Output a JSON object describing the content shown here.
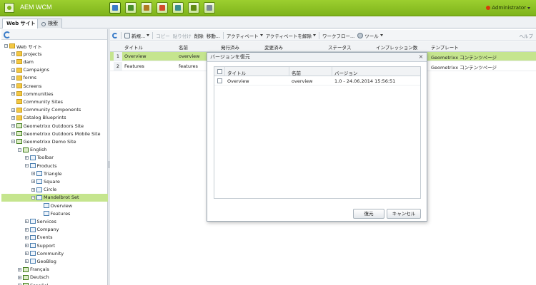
{
  "app": {
    "title": "AEM WCM",
    "user": "Administrator"
  },
  "tabs": [
    {
      "label": "Web サイト"
    },
    {
      "label": "検索"
    }
  ],
  "tree": [
    {
      "label": "Web サイト",
      "level": 0,
      "icon": "folder-icon"
    },
    {
      "label": "projects",
      "level": 1,
      "icon": "folder-icon"
    },
    {
      "label": "dam",
      "level": 1,
      "icon": "folder-icon"
    },
    {
      "label": "Campaigns",
      "level": 1,
      "icon": "folder-icon"
    },
    {
      "label": "forms",
      "level": 1,
      "icon": "folder-icon"
    },
    {
      "label": "Screens",
      "level": 1,
      "icon": "folder-icon"
    },
    {
      "label": "communities",
      "level": 1,
      "icon": "folder-icon"
    },
    {
      "label": "Community Sites",
      "level": 1,
      "icon": "folder-icon"
    },
    {
      "label": "Community Components",
      "level": 1,
      "icon": "folder-icon"
    },
    {
      "label": "Catalog Blueprints",
      "level": 1,
      "icon": "folder-icon"
    },
    {
      "label": "Geometrixx Outdoors Site",
      "level": 1,
      "icon": "site-icon"
    },
    {
      "label": "Geometrixx Outdoors Mobile Site",
      "level": 1,
      "icon": "site-icon"
    },
    {
      "label": "Geometrixx Demo Site",
      "level": 1,
      "icon": "site-icon"
    },
    {
      "label": "English",
      "level": 2,
      "icon": "site-icon"
    },
    {
      "label": "Toolbar",
      "level": 3,
      "icon": "page-icon"
    },
    {
      "label": "Products",
      "level": 3,
      "icon": "page-icon"
    },
    {
      "label": "Triangle",
      "level": 4,
      "icon": "page-icon"
    },
    {
      "label": "Square",
      "level": 4,
      "icon": "page-icon"
    },
    {
      "label": "Circle",
      "level": 4,
      "icon": "page-icon"
    },
    {
      "label": "Mandelbrot Set",
      "level": 4,
      "icon": "page-icon"
    },
    {
      "label": "Overview",
      "level": 5,
      "icon": "page-icon"
    },
    {
      "label": "Features",
      "level": 5,
      "icon": "page-icon"
    },
    {
      "label": "Services",
      "level": 3,
      "icon": "page-icon"
    },
    {
      "label": "Company",
      "level": 3,
      "icon": "page-icon"
    },
    {
      "label": "Events",
      "level": 3,
      "icon": "page-icon"
    },
    {
      "label": "Support",
      "level": 3,
      "icon": "page-icon"
    },
    {
      "label": "Community",
      "level": 3,
      "icon": "page-icon"
    },
    {
      "label": "GeoBlog",
      "level": 3,
      "icon": "page-icon"
    },
    {
      "label": "Français",
      "level": 2,
      "icon": "site-icon"
    },
    {
      "label": "Deutsch",
      "level": 2,
      "icon": "site-icon"
    },
    {
      "label": "Español",
      "level": 2,
      "icon": "site-icon"
    }
  ],
  "toolbar": {
    "new_label": "新規...",
    "copy_label": "コピー",
    "paste_label": "貼り付け",
    "delete_label": "削除",
    "move_label": "移動...",
    "activate_label": "アクティベート",
    "deactivate_label": "アクティベートを解除",
    "workflow_label": "ワークフロー...",
    "tools_label": "ツール",
    "help_label": "ヘルプ"
  },
  "grid": {
    "columns": [
      "タイトル",
      "名前",
      "発行済み",
      "変更済み",
      "ステータス",
      "インプレッション数",
      "テンプレート"
    ],
    "rows": [
      {
        "num": "1",
        "title": "Overview",
        "name": "overview",
        "template": "Geometrixx コンテンツページ"
      },
      {
        "num": "2",
        "title": "Features",
        "name": "features",
        "template": "Geometrixx コンテンツページ"
      }
    ]
  },
  "dialog": {
    "title": "バージョンを復元",
    "columns": [
      "タイトル",
      "名前",
      "バージョン"
    ],
    "rows": [
      {
        "title": "Overview",
        "name": "overview",
        "version": "1.0 - 24.06.2014 15:56:51"
      }
    ],
    "restore_label": "復元",
    "cancel_label": "キャンセル"
  }
}
